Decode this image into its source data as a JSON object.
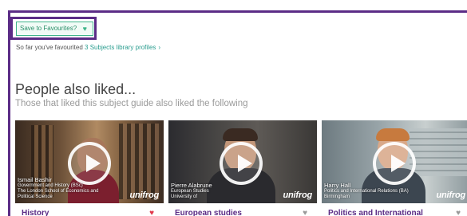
{
  "favourites": {
    "button_label": "Save to Favourites?",
    "count_prefix": "So far you've favourited",
    "count_link": "3 Subjects library profiles"
  },
  "section": {
    "title": "People also liked...",
    "subtitle": "Those that liked this subject guide also liked the following"
  },
  "cards": [
    {
      "title": "History",
      "person_name": "Ismail Bashir",
      "person_line1": "Government and History (BSc)",
      "person_line2": "The London School of Economics and",
      "person_line3": "Political Science",
      "logo": "unifrog",
      "favourited": true,
      "heart_color": "#e0384b"
    },
    {
      "title": "European studies",
      "person_name": "Pierre Alabrune",
      "person_line1": "European Studies",
      "person_line2": "University of",
      "person_line3": "",
      "logo": "unifrog",
      "favourited": false,
      "heart_color": "#9a9a9a"
    },
    {
      "title": "Politics and International",
      "person_name": "Harry Hall",
      "person_line1": "Politics and International Relations (BA)",
      "person_line2": "Birmingham",
      "person_line3": "",
      "logo": "unifrog",
      "favourited": false,
      "heart_color": "#9a9a9a"
    }
  ],
  "colors": {
    "accent_purple": "#5b2c86",
    "accent_green": "#3fb58a",
    "link_teal": "#2a9d8f"
  },
  "icons": {
    "favourite": "heart-icon",
    "link": "chevron-right-icon",
    "video": "play-icon"
  }
}
